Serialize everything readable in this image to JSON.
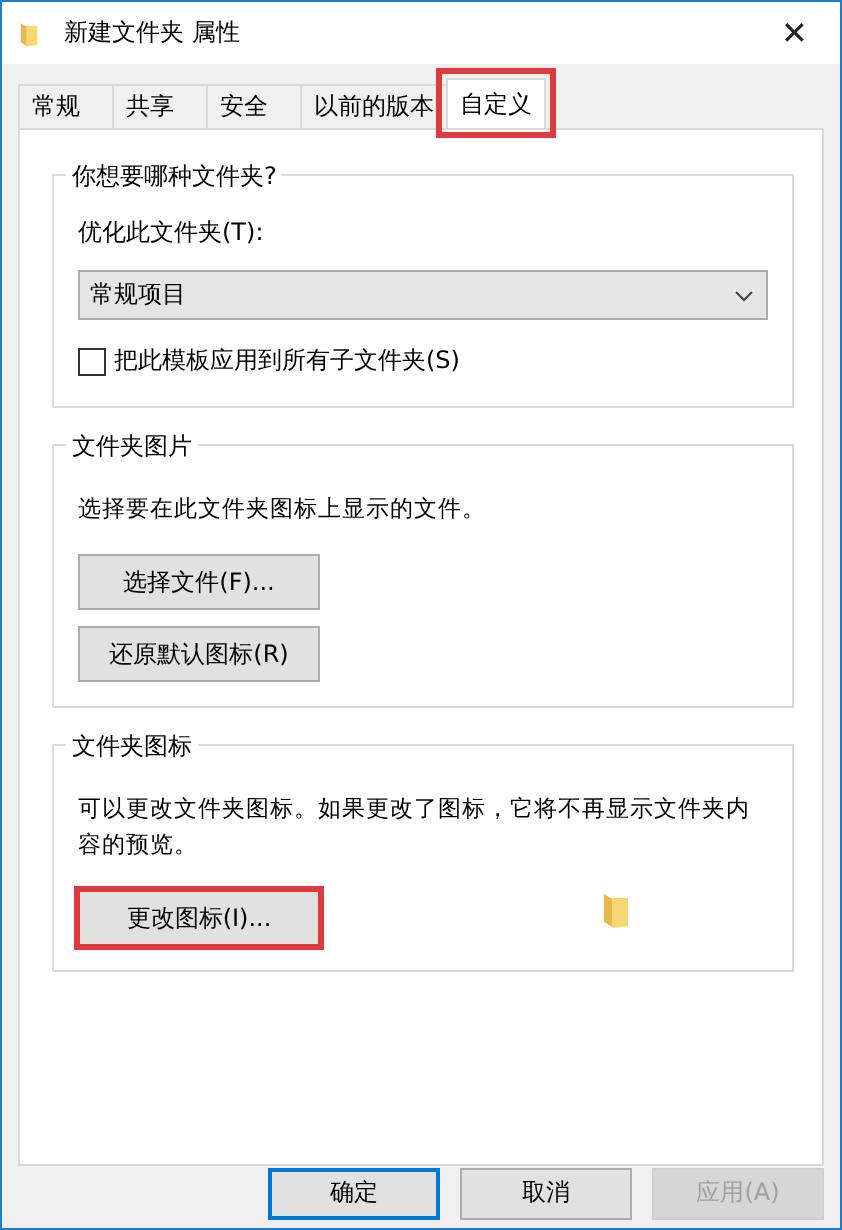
{
  "window": {
    "title": "新建文件夹 属性",
    "close": "✕"
  },
  "tabs": [
    {
      "label": "常规",
      "selected": false,
      "highlighted": false
    },
    {
      "label": "共享",
      "selected": false,
      "highlighted": false
    },
    {
      "label": "安全",
      "selected": false,
      "highlighted": false
    },
    {
      "label": "以前的版本",
      "selected": false,
      "highlighted": false
    },
    {
      "label": "自定义",
      "selected": true,
      "highlighted": true
    }
  ],
  "groups": [
    {
      "title": "你想要哪种文件夹?",
      "items": [
        {
          "kind": "label",
          "text": "优化此文件夹(T):"
        },
        {
          "kind": "dropdown",
          "value": "常规项目"
        },
        {
          "kind": "checkbox",
          "text": "把此模板应用到所有子文件夹(S)",
          "checked": false
        }
      ]
    },
    {
      "title": "文件夹图片",
      "items": [
        {
          "kind": "text",
          "text": "选择要在此文件夹图标上显示的文件。"
        },
        {
          "kind": "button",
          "text": "选择文件(F)...",
          "highlighted": false
        },
        {
          "kind": "button",
          "text": "还原默认图标(R)",
          "highlighted": false
        }
      ]
    },
    {
      "title": "文件夹图标",
      "items": [
        {
          "kind": "text",
          "text": "可以更改文件夹图标。如果更改了图标，它将不再显示文件夹内容的预览。"
        },
        {
          "kind": "button-preview",
          "text": "更改图标(I)...",
          "highlighted": true
        }
      ]
    }
  ],
  "buttons": [
    {
      "label": "确定",
      "default": true,
      "disabled": false
    },
    {
      "label": "取消",
      "default": false,
      "disabled": false
    },
    {
      "label": "应用(A)",
      "default": false,
      "disabled": true
    }
  ]
}
